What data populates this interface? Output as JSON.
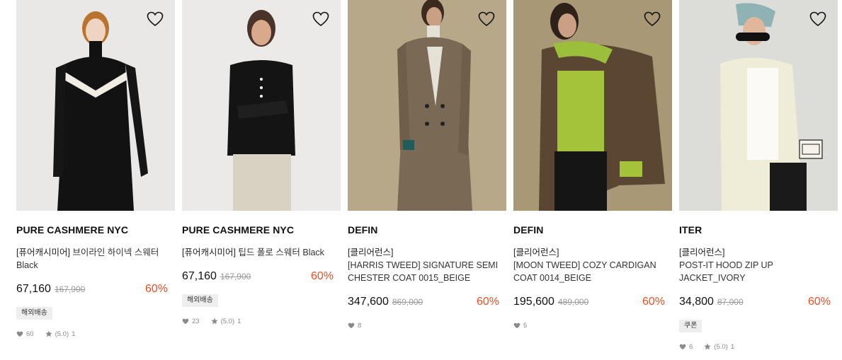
{
  "products": [
    {
      "brand": "PURE CASHMERE NYC",
      "tag": "[퓨어캐시미어]",
      "name": " 브이라인 하이넥 스웨터",
      "name2": "Black",
      "price": "67,160",
      "original_price": "167,900",
      "discount": "60%",
      "badge": "해외배송",
      "likes": "60",
      "rating": "(5.0)",
      "reviews": "1"
    },
    {
      "brand": "PURE CASHMERE NYC",
      "tag": "[퓨어캐시미어]",
      "name": " 팁드 폴로 스웨터",
      "name2": "Black",
      "price": "67,160",
      "original_price": "167,900",
      "discount": "60%",
      "badge": "해외배송",
      "likes": "23",
      "rating": "(5.0)",
      "reviews": "1"
    },
    {
      "brand": "DEFIN",
      "tag": "[클리어런스]",
      "name": "[HARRIS TWEED] SIGNATURE SEMI CHESTER COAT 0015_BEIGE",
      "price": "347,600",
      "original_price": "869,000",
      "discount": "60%",
      "likes": "8"
    },
    {
      "brand": "DEFIN",
      "tag": "[클리어런스]",
      "name": "[MOON TWEED] COZY CARDIGAN COAT 0014_BEIGE",
      "price": "195,600",
      "original_price": "489,000",
      "discount": "60%",
      "likes": "5"
    },
    {
      "brand": "ITER",
      "tag": "[클리어런스]",
      "name": "POST-IT HOOD ZIP UP JACKET_IVORY",
      "price": "34,800",
      "original_price": "87,000",
      "discount": "60%",
      "badge": "쿠폰",
      "likes": "6",
      "rating": "(5.0)",
      "reviews": "1"
    }
  ],
  "icons": {
    "wishlist": "heart-outline-icon",
    "likes": "heart-icon",
    "rating": "star-icon"
  },
  "colors": {
    "discount": "#f04e23",
    "badge_bg": "#eeeeee"
  }
}
